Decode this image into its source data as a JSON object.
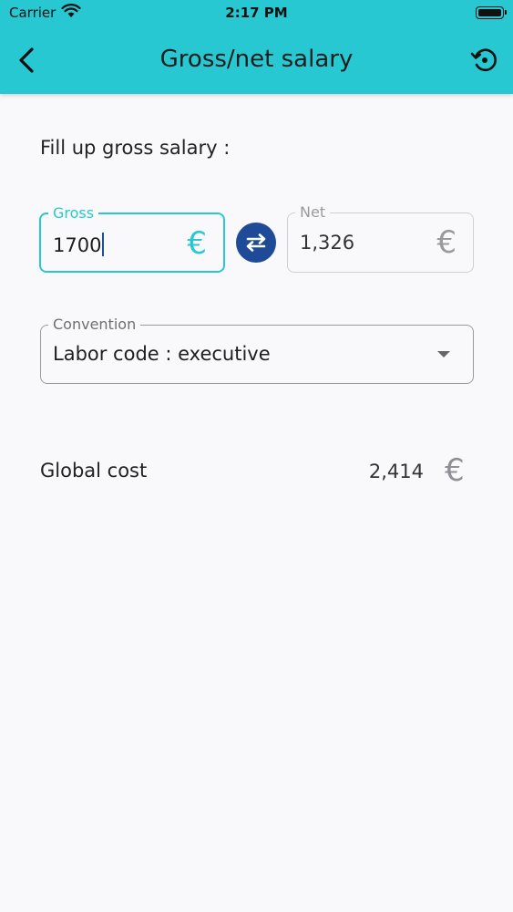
{
  "status_bar": {
    "carrier": "Carrier",
    "time": "2:17 PM"
  },
  "header": {
    "title": "Gross/net salary",
    "back_icon": "chevron-left-icon",
    "history_icon": "history-icon"
  },
  "form": {
    "prompt": "Fill up gross salary :",
    "gross": {
      "label": "Gross",
      "value": "1700",
      "currency": "€"
    },
    "net": {
      "label": "Net",
      "value": "1,326",
      "currency": "€"
    },
    "swap_icon": "swap-arrows-icon",
    "convention": {
      "label": "Convention",
      "value": "Labor code : executive"
    }
  },
  "result": {
    "label": "Global cost",
    "value": "2,414",
    "currency": "€"
  },
  "colors": {
    "accent": "#27c8d2",
    "swap_button": "#1e4a98",
    "background": "#f9f8fb"
  }
}
